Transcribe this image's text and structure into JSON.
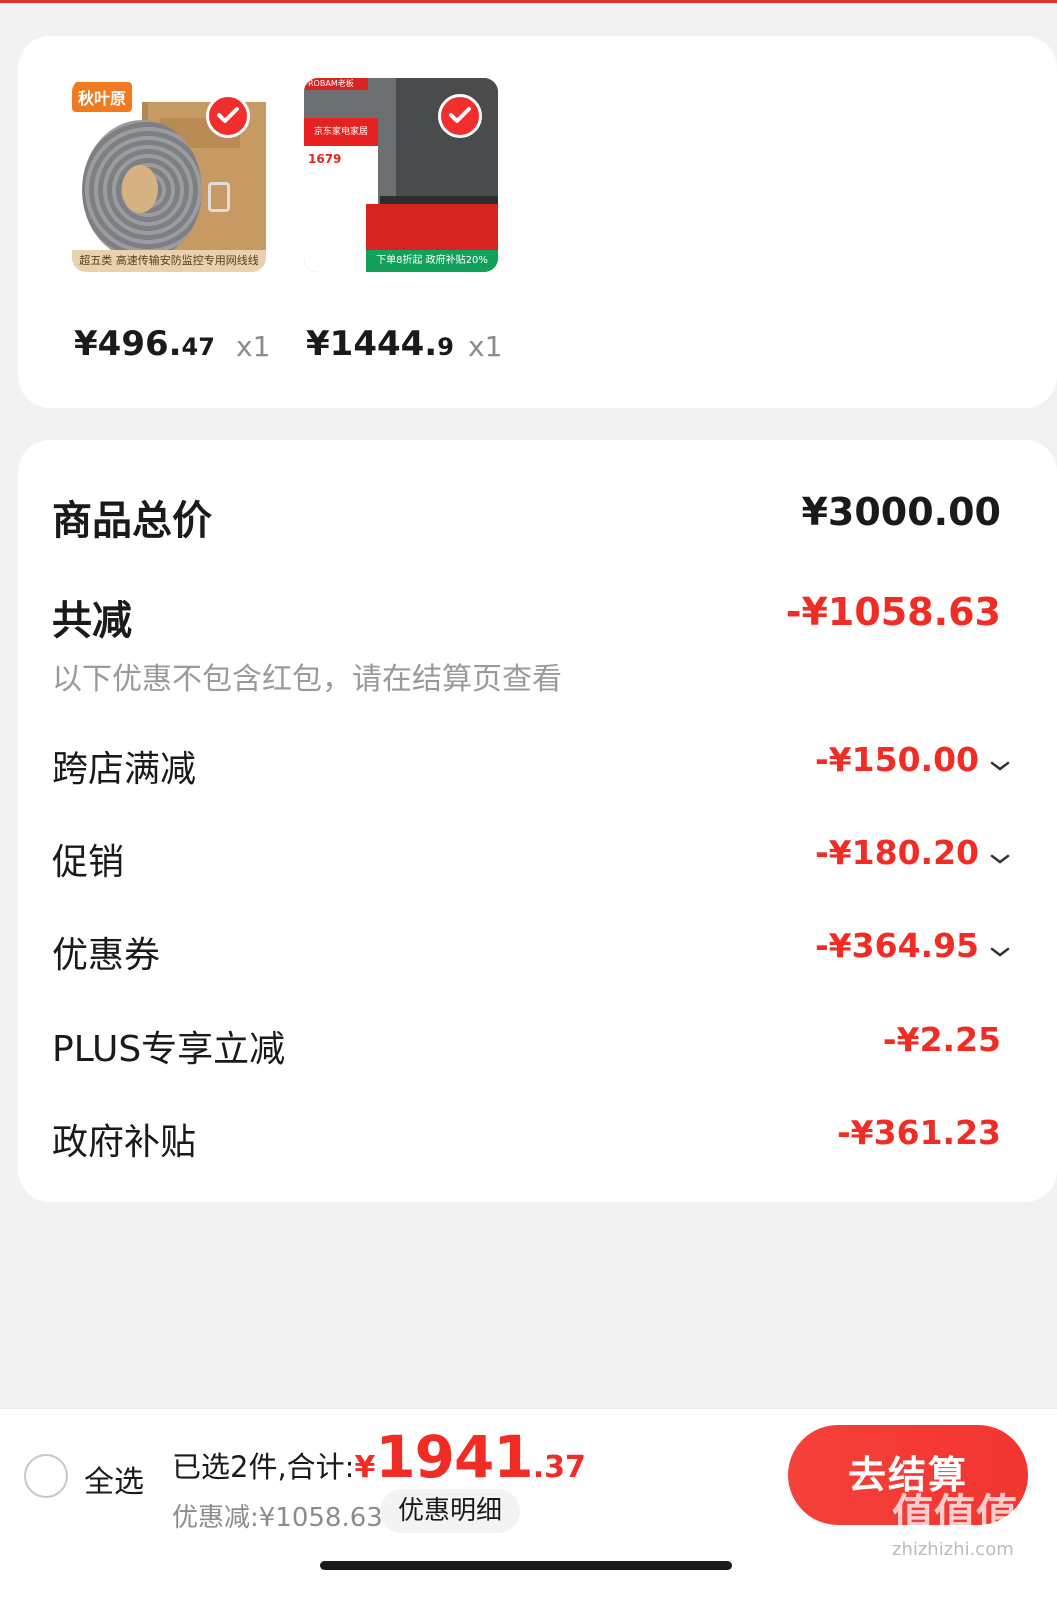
{
  "products": [
    {
      "brand_tag": "秋叶原",
      "caption": "超五类 高速传输安防监控专用网线线",
      "price_int": "¥496.",
      "price_dec": "47",
      "qty": "x1"
    },
    {
      "brand_tag": "ROBAM老板",
      "promo_price": "1679",
      "promo_banner": "下单8折起 政府补贴20%",
      "price_int": "¥1444.",
      "price_dec": "9",
      "qty": "x1"
    }
  ],
  "summary": {
    "total_label": "商品总价",
    "total_value": "¥3000.00",
    "reduce_label": "共减",
    "reduce_value": "-¥1058.63",
    "note": "以下优惠不包含红包，请在结算页查看",
    "items": [
      {
        "label": "跨店满减",
        "value": "-¥150.00"
      },
      {
        "label": "促销",
        "value": "-¥180.20"
      },
      {
        "label": "优惠券",
        "value": "-¥364.95"
      },
      {
        "label": "PLUS专享立减",
        "value": "-¥2.25"
      },
      {
        "label": "政府补贴",
        "value": "-¥361.23"
      }
    ]
  },
  "bottom": {
    "select_all": "全选",
    "selected_text": "已选2件,合计:",
    "total_yen": "¥",
    "total_int": "1941",
    "total_dec": ".37",
    "discount_text": "优惠减:¥1058.63",
    "detail_button": "优惠明细",
    "checkout_button": "去结算",
    "watermark": "值值值",
    "watermark_url": "zhizhizhi.com"
  },
  "colors": {
    "accent_red": "#f02c25",
    "checkout_red": "#f6403a",
    "background": "#f2f2f2"
  }
}
